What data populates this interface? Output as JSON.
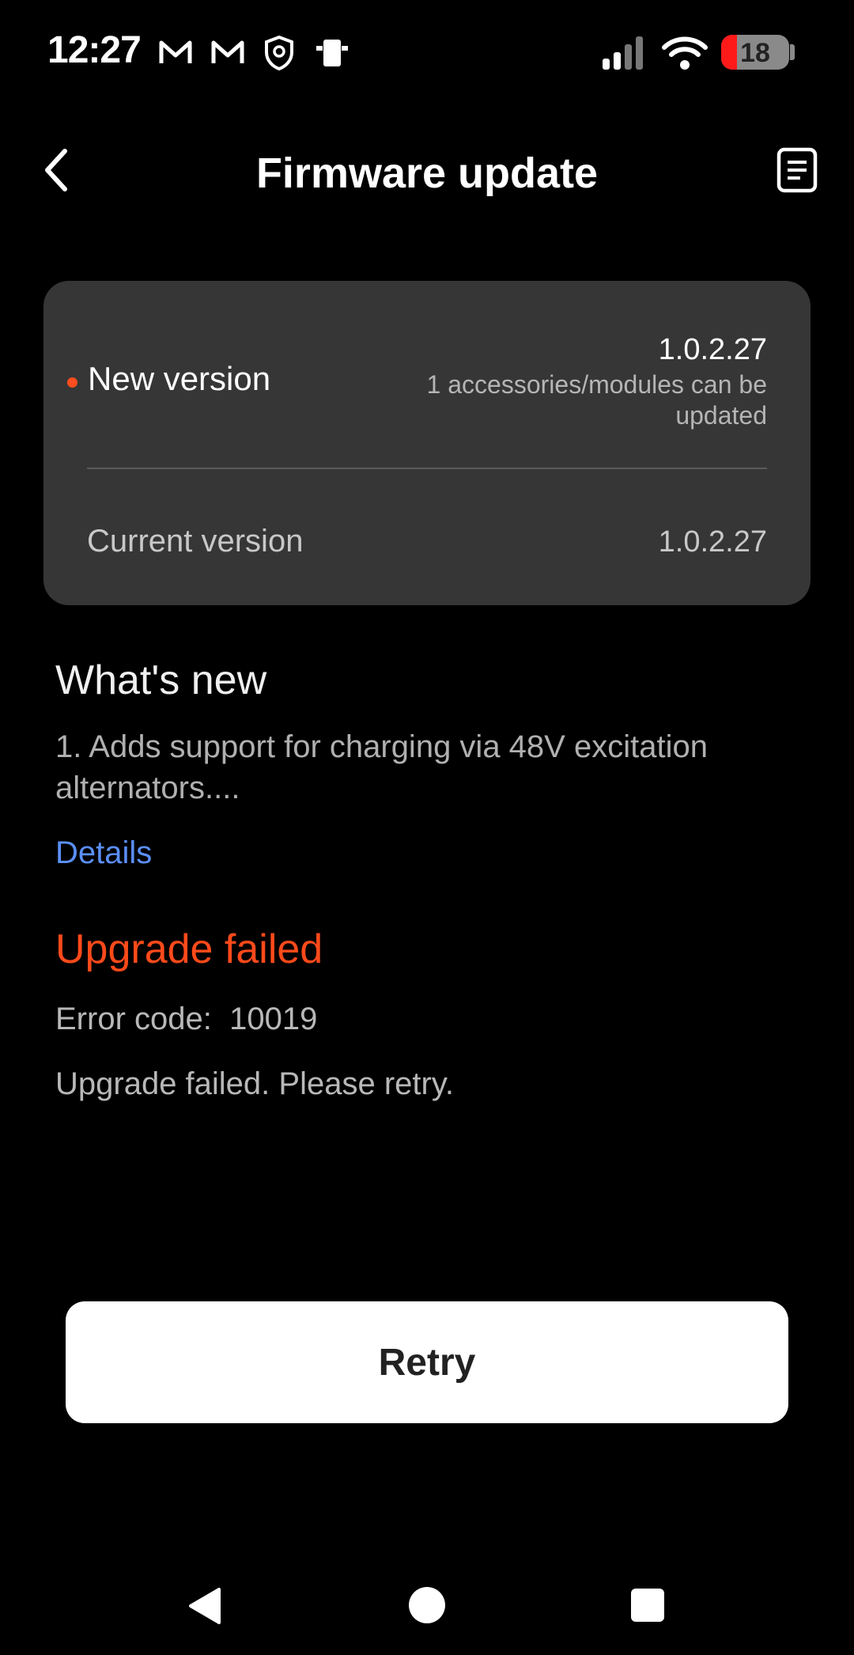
{
  "status_bar": {
    "time": "12:27",
    "battery": "18",
    "icons": [
      "gmail-icon",
      "gmail-icon",
      "shield-icon",
      "device-icon",
      "signal-icon",
      "wifi-icon",
      "battery-icon"
    ]
  },
  "header": {
    "title": "Firmware update",
    "back_icon": "chevron-left-icon",
    "log_icon": "document-list-icon"
  },
  "version_card": {
    "new_label": "New version",
    "new_version": "1.0.2.27",
    "new_sub": "1 accessories/modules can be updated",
    "current_label": "Current version",
    "current_version": "1.0.2.27"
  },
  "whats_new": {
    "title": "What's new",
    "text": "1. Adds support for charging via 48V excitation alternators....",
    "details_link": "Details"
  },
  "error": {
    "title": "Upgrade failed",
    "code_text": "Error code:  10019",
    "message": "Upgrade failed. Please retry."
  },
  "actions": {
    "retry_label": "Retry"
  },
  "colors": {
    "accent_error": "#ff4a1a",
    "link": "#5b8ff9",
    "card_bg": "#363636"
  }
}
